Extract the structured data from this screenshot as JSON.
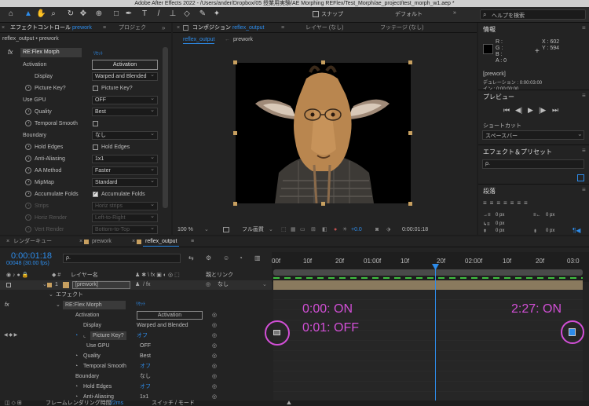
{
  "window_title": "Adobe After Effects 2022 - /Users/ander/Dropbox/05 授業用実験/AE Morphing REFlex/Test_Morph/ae_project/test_morph_w1.aep *",
  "toolbar": {
    "snap_label": "スナップ",
    "workspace": "デフォルト",
    "search_placeholder": "ヘルプを検索"
  },
  "effect_controls": {
    "tab_label": "エフェクトコントロール",
    "tab_comp": "prework",
    "tab_project": "プロジェク",
    "breadcrumb": "reflex_output • prework",
    "effect_name": "RE:Flex Morph",
    "reset": "ﾘｾｯﾄ",
    "rows": [
      {
        "label": "Activation",
        "button": "Activation"
      },
      {
        "label": "Display",
        "value": "Warped and Blended"
      },
      {
        "label": "Picture Key?",
        "check": "Picture Key?"
      },
      {
        "label": "Use GPU",
        "value": "OFF"
      },
      {
        "label": "Quality",
        "value": "Best"
      },
      {
        "label": "Temporal Smooth",
        "check": ""
      },
      {
        "label": "Boundary",
        "value": "なし"
      },
      {
        "label": "Hold Edges",
        "check": "Hold Edges"
      },
      {
        "label": "Anti-Aliasing",
        "value": "1x1"
      },
      {
        "label": "AA Method",
        "value": "Faster"
      },
      {
        "label": "MipMap",
        "value": "Standard"
      },
      {
        "label": "Accumulate Folds",
        "check": "Accumulate Folds"
      },
      {
        "label": "Strips",
        "value": "Horiz strips"
      },
      {
        "label": "Horiz Render",
        "value": "Left-to-Right"
      },
      {
        "label": "Vert Render",
        "value": "Bottom-to-Top"
      }
    ]
  },
  "composition": {
    "tab_prefix": "コンポジション",
    "tab_name": "reflex_output",
    "layer_tab": "レイヤー (なし)",
    "footage_tab": "フッテージ (なし)",
    "sub_tabs": [
      "reflex_output",
      "prework"
    ],
    "zoom": "100 %",
    "quality": "フル画質",
    "exposure": "+0.0",
    "timecode": "0:00:01:18"
  },
  "info_panel": {
    "title": "情報",
    "r": "R :",
    "g": "G :",
    "b": "B :",
    "a": "A :  0",
    "x": "X : 602",
    "y": "Y : 594",
    "layer": "[prework]",
    "duration": "デュレーション : 0:00:03:00",
    "in_point": "イン : 0:00:00:00"
  },
  "preview": {
    "title": "プレビュー",
    "shortcut_label": "ショートカット",
    "shortcut_value": "スペースバー"
  },
  "effects_presets": {
    "title": "エフェクト＆プリセット",
    "search": "ρ."
  },
  "paragraph": {
    "title": "段落",
    "values": [
      "0 px",
      "0 px",
      "0 px",
      "0 px",
      "0 px"
    ]
  },
  "timeline": {
    "tabs": [
      "レンダーキュー",
      "prework",
      "reflex_output"
    ],
    "timecode": "0:00:01:18",
    "frames": "00048 (30.00 fps)",
    "search": "ρ.",
    "layer_name_header": "レイヤー名",
    "parent_header": "親とリンク",
    "ruler": [
      "00f",
      "10f",
      "20f",
      "01:00f",
      "10f",
      "20f",
      "02:00f",
      "10f",
      "20f",
      "03:0"
    ],
    "layer_num": "1",
    "layer_name": "[prework]",
    "parent_value": "なし",
    "rows": [
      {
        "label": "エフェクト",
        "indent": 12
      },
      {
        "label": "RE:Flex Morph",
        "reset": "ﾘｾｯﾄ",
        "indent": 20
      },
      {
        "label": "Activation",
        "button": "Activation",
        "indent": 32
      },
      {
        "label": "Display",
        "value": "Warped and Blended",
        "indent": 32
      },
      {
        "label": "Picture Key?",
        "value_blue": "オフ",
        "indent": 32
      },
      {
        "label": "Use GPU",
        "value": "OFF",
        "indent": 32
      },
      {
        "label": "Quality",
        "value": "Best",
        "indent": 32
      },
      {
        "label": "Temporal Smooth",
        "value_blue": "オフ",
        "indent": 32
      },
      {
        "label": "Boundary",
        "value": "なし",
        "indent": 32
      },
      {
        "label": "Hold Edges",
        "value_blue": "オフ",
        "indent": 32
      },
      {
        "label": "Anti-Aliasing",
        "value": "1x1",
        "indent": 32
      }
    ],
    "bottom_left": "フレームレンダリング時間",
    "render_time": "22ms",
    "toggle_mode": "スイッチ / モード"
  },
  "annotations": {
    "on_start": "0:00: ON",
    "off": "0:01: OFF",
    "on_end": "2:27: ON"
  },
  "colors": {
    "accent_blue": "#2d8ceb",
    "annotation_magenta": "#d24fd6",
    "layer_bar": "#8a7a5e"
  }
}
